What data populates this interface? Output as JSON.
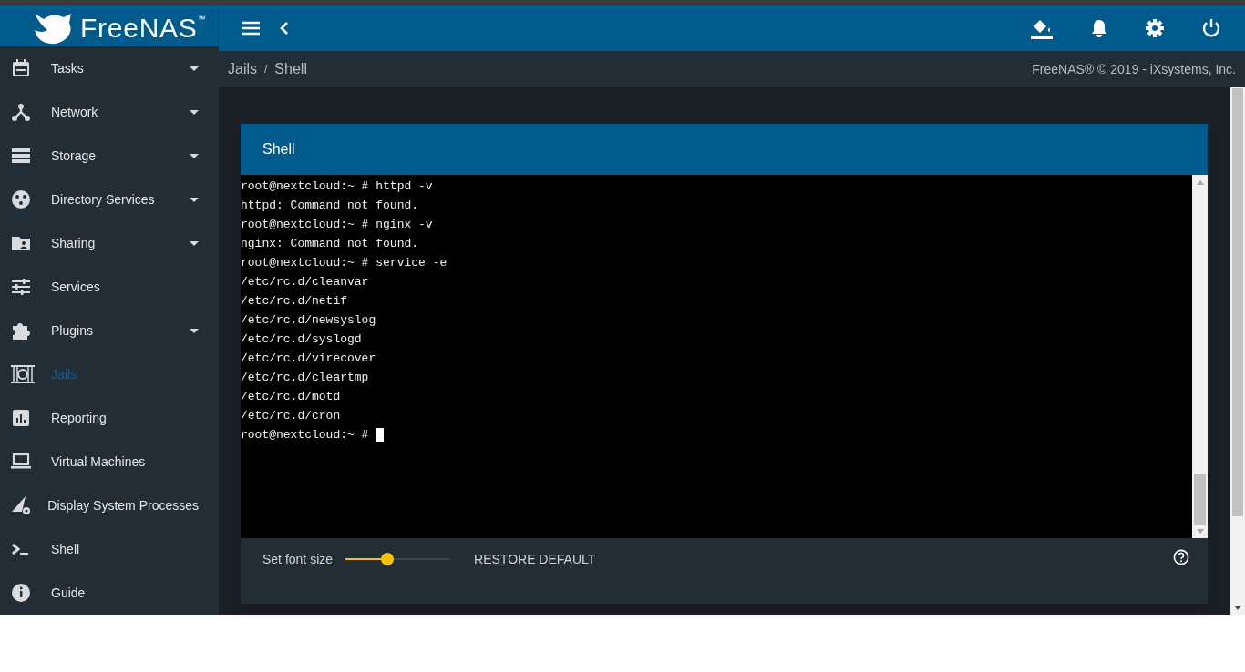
{
  "header": {
    "logo_text": "FreeNAS",
    "logo_mark": "™"
  },
  "sidebar": {
    "items": [
      {
        "label": "Tasks",
        "kind": "calendar",
        "expandable": true,
        "selected": false
      },
      {
        "label": "Network",
        "kind": "network",
        "expandable": true,
        "selected": false
      },
      {
        "label": "Storage",
        "kind": "storage",
        "expandable": true,
        "selected": false
      },
      {
        "label": "Directory Services",
        "kind": "directory",
        "expandable": true,
        "selected": false
      },
      {
        "label": "Sharing",
        "kind": "folder",
        "expandable": true,
        "selected": false
      },
      {
        "label": "Services",
        "kind": "sliders",
        "expandable": false,
        "selected": false
      },
      {
        "label": "Plugins",
        "kind": "puzzle",
        "expandable": true,
        "selected": false
      },
      {
        "label": "Jails",
        "kind": "jail",
        "expandable": false,
        "selected": true
      },
      {
        "label": "Reporting",
        "kind": "chart",
        "expandable": false,
        "selected": false
      },
      {
        "label": "Virtual Machines",
        "kind": "laptop",
        "expandable": false,
        "selected": false
      },
      {
        "label": "Display System Processes",
        "kind": "processes",
        "expandable": false,
        "selected": false
      },
      {
        "label": "Shell",
        "kind": "terminal",
        "expandable": false,
        "selected": false
      },
      {
        "label": "Guide",
        "kind": "info",
        "expandable": false,
        "selected": false
      }
    ]
  },
  "breadcrumb": [
    "Jails",
    "Shell"
  ],
  "breadcrumb_separator": "/",
  "copyright": "FreeNAS® © 2019 - iXsystems, Inc.",
  "card": {
    "title": "Shell",
    "terminal_lines": [
      "root@nextcloud:~ # httpd -v",
      "httpd: Command not found.",
      "root@nextcloud:~ # nginx -v",
      "nginx: Command not found.",
      "root@nextcloud:~ # service -e",
      "/etc/rc.d/cleanvar",
      "/etc/rc.d/netif",
      "/etc/rc.d/newsyslog",
      "/etc/rc.d/syslogd",
      "/etc/rc.d/virecover",
      "/etc/rc.d/cleartmp",
      "/etc/rc.d/motd",
      "/etc/rc.d/cron",
      "root@nextcloud:~ # "
    ],
    "font_size": {
      "label": "Set font size",
      "level": 0.4
    },
    "restore_button": "RESTORE DEFAULT"
  }
}
